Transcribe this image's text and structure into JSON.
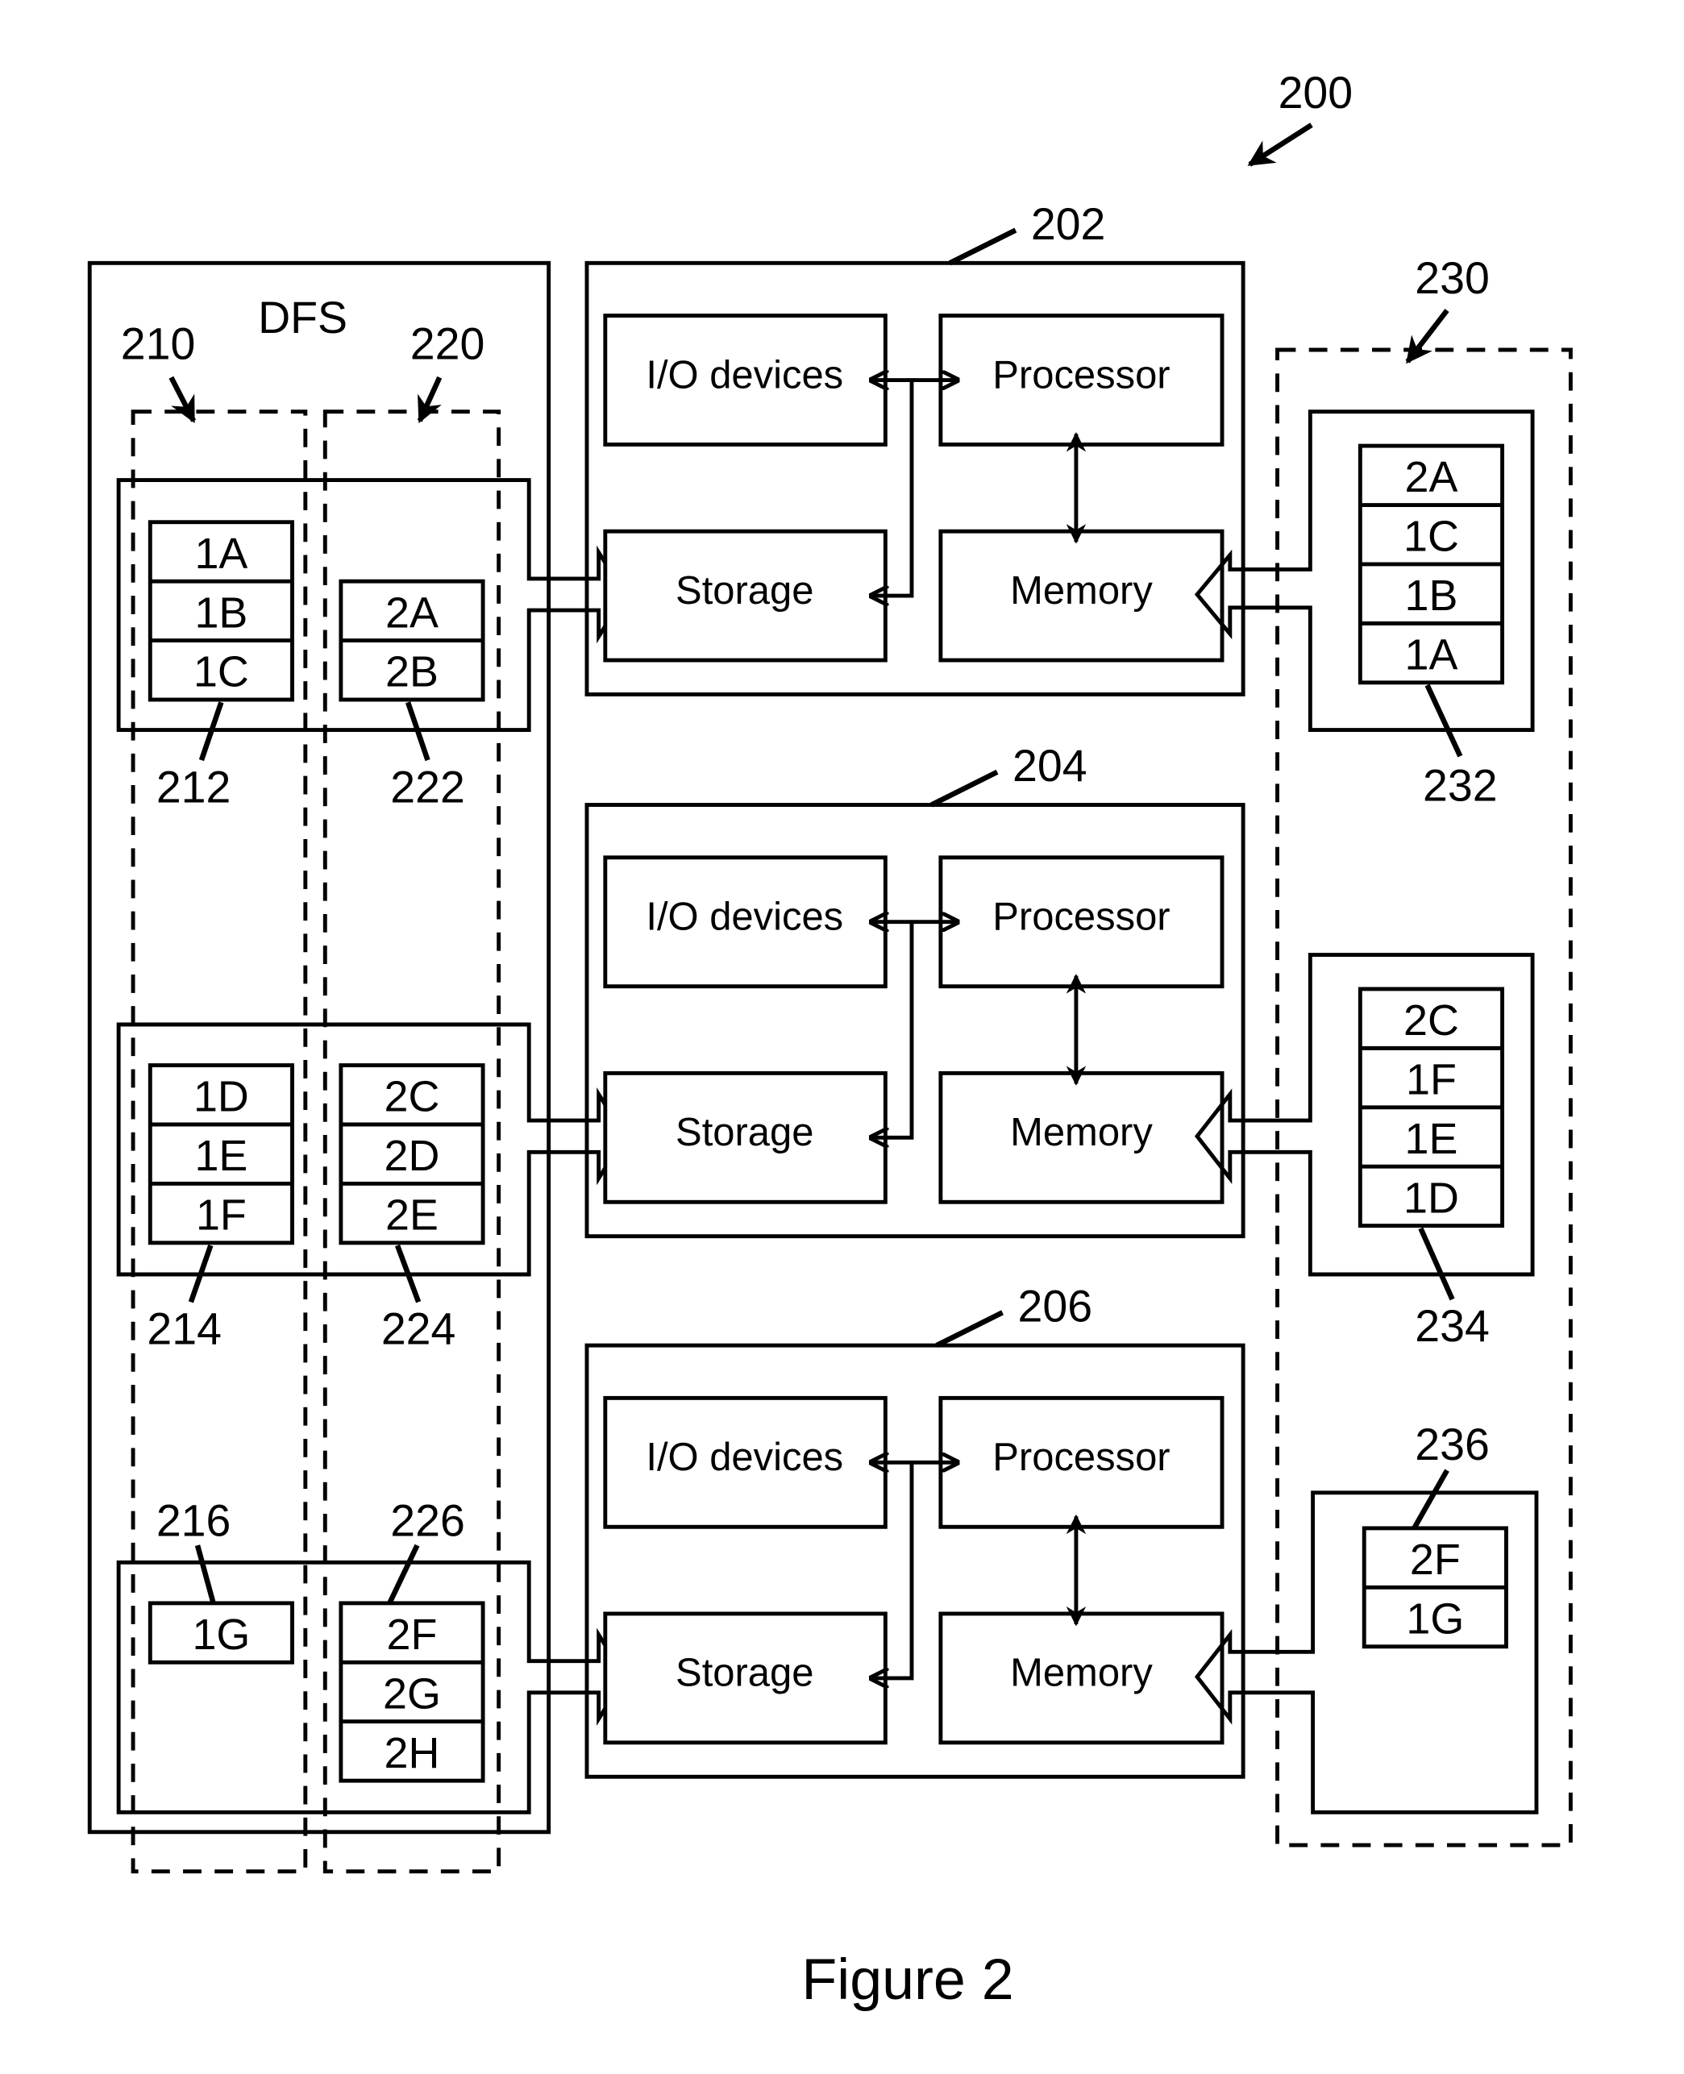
{
  "figure": {
    "ref": "200",
    "caption": "Figure 2"
  },
  "dfs": {
    "title": "DFS",
    "groups": [
      {
        "ref": "210"
      },
      {
        "ref": "220"
      }
    ],
    "rows": [
      {
        "left": {
          "ref": "212",
          "blocks": [
            "1A",
            "1B",
            "1C"
          ]
        },
        "right": {
          "ref": "222",
          "blocks": [
            "2A",
            "2B"
          ]
        }
      },
      {
        "left": {
          "ref": "214",
          "blocks": [
            "1D",
            "1E",
            "1F"
          ]
        },
        "right": {
          "ref": "224",
          "blocks": [
            "2C",
            "2D",
            "2E"
          ]
        }
      },
      {
        "left": {
          "ref": "216",
          "blocks": [
            "1G"
          ]
        },
        "right": {
          "ref": "226",
          "blocks": [
            "2F",
            "2G",
            "2H"
          ]
        }
      }
    ]
  },
  "nodes": [
    {
      "ref": "202",
      "io": "I/O devices",
      "processor": "Processor",
      "storage": "Storage",
      "memory": "Memory"
    },
    {
      "ref": "204",
      "io": "I/O devices",
      "processor": "Processor",
      "storage": "Storage",
      "memory": "Memory"
    },
    {
      "ref": "206",
      "io": "I/O devices",
      "processor": "Processor",
      "storage": "Storage",
      "memory": "Memory"
    }
  ],
  "cache": {
    "ref": "230",
    "stacks": [
      {
        "ref": "232",
        "blocks": [
          "2A",
          "1C",
          "1B",
          "1A"
        ]
      },
      {
        "ref": "234",
        "blocks": [
          "2C",
          "1F",
          "1E",
          "1D"
        ]
      },
      {
        "ref": "236",
        "blocks": [
          "2F",
          "1G"
        ]
      }
    ]
  }
}
